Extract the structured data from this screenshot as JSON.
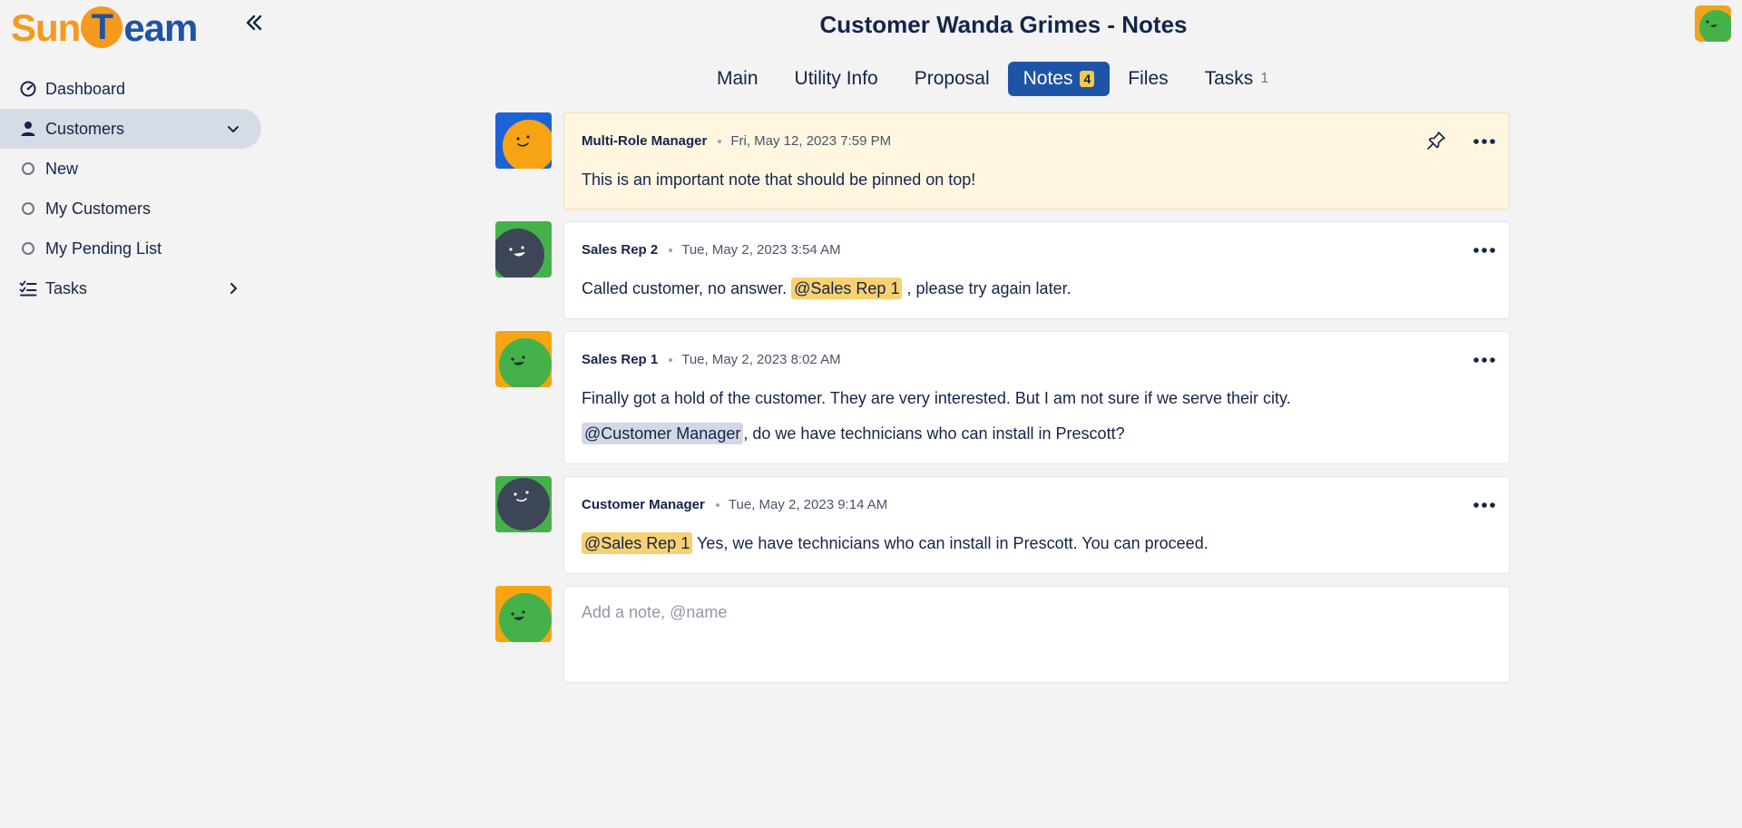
{
  "app": {
    "logo_sun": "Sun",
    "logo_t": "T",
    "logo_team": "eam"
  },
  "sidebar": {
    "items": [
      {
        "label": "Dashboard",
        "icon": "gauge-icon"
      },
      {
        "label": "Customers",
        "icon": "person-icon",
        "active": true,
        "expanded": true
      },
      {
        "label": "New",
        "icon": "circle-icon"
      },
      {
        "label": "My Customers",
        "icon": "circle-icon"
      },
      {
        "label": "My Pending List",
        "icon": "circle-icon"
      },
      {
        "label": "Tasks",
        "icon": "checklist-icon"
      }
    ]
  },
  "header": {
    "title": "Customer Wanda Grimes - Notes"
  },
  "tabs": [
    {
      "label": "Main"
    },
    {
      "label": "Utility Info"
    },
    {
      "label": "Proposal"
    },
    {
      "label": "Notes",
      "count": "4",
      "active": true
    },
    {
      "label": "Files"
    },
    {
      "label": "Tasks",
      "count": "1"
    }
  ],
  "notes": [
    {
      "author": "Multi-Role Manager",
      "time": "Fri, May 12, 2023 7:59 PM",
      "pinned": true,
      "text": "This is an important note that should be pinned on top!"
    },
    {
      "author": "Sales Rep 2",
      "time": "Tue, May 2, 2023 3:54 AM",
      "text_before": "Called customer, no answer. ",
      "mention": "@Sales Rep 1",
      "text_after": " , please try again later."
    },
    {
      "author": "Sales Rep 1",
      "time": "Tue, May 2, 2023 8:02 AM",
      "line1": "Finally got a hold of the customer. They are very interested. But I am not sure if we serve their city.",
      "mention": "@Customer Manager",
      "line2_after": ", do we have technicians who can install in Prescott?"
    },
    {
      "author": "Customer Manager",
      "time": "Tue, May 2, 2023 9:14 AM",
      "mention": "@Sales Rep 1",
      "text_after": " Yes, we have technicians who can install in Prescott. You can proceed."
    }
  ],
  "compose": {
    "placeholder": "Add a note, @name"
  },
  "colors": {
    "brand_blue": "#1e54a6",
    "brand_orange": "#f39a1f",
    "mention_yellow": "#f8d170",
    "mention_gray": "#d3d9e2",
    "pinned_bg": "#fff6e0"
  }
}
